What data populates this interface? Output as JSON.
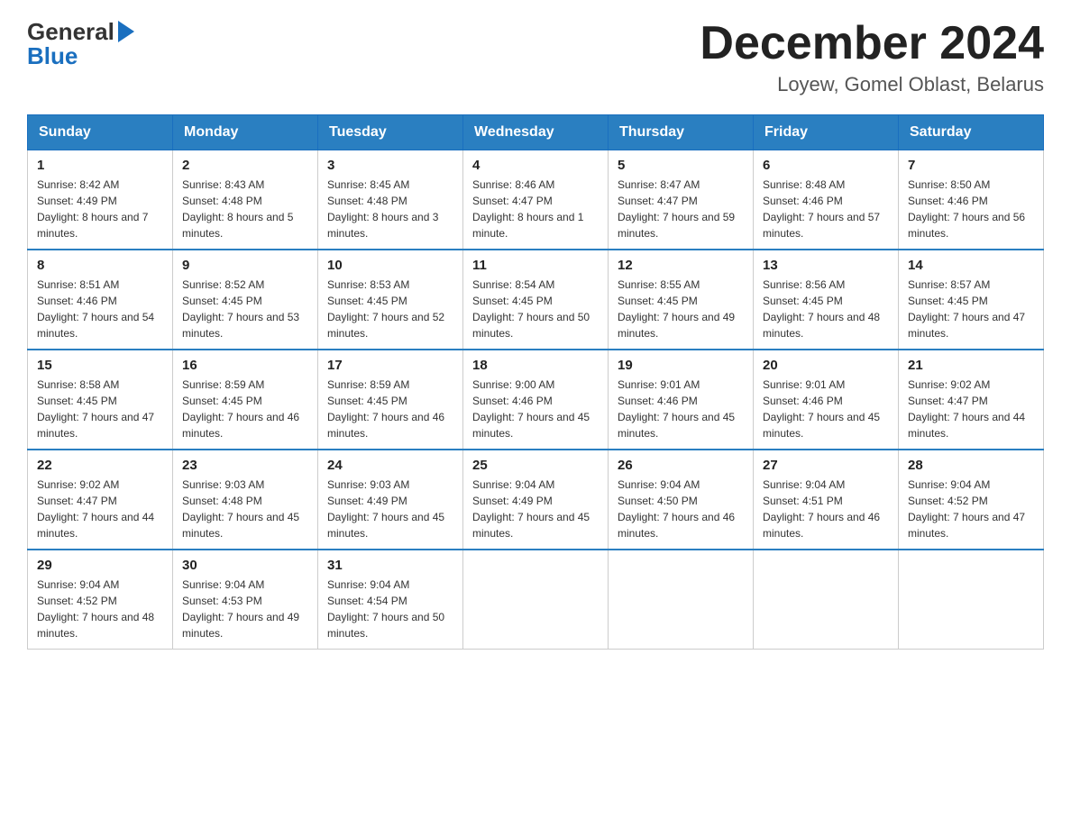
{
  "header": {
    "logo_general": "General",
    "logo_blue": "Blue",
    "month_title": "December 2024",
    "location": "Loyew, Gomel Oblast, Belarus"
  },
  "days_of_week": [
    "Sunday",
    "Monday",
    "Tuesday",
    "Wednesday",
    "Thursday",
    "Friday",
    "Saturday"
  ],
  "weeks": [
    [
      {
        "day": "1",
        "sunrise": "8:42 AM",
        "sunset": "4:49 PM",
        "daylight": "8 hours and 7 minutes."
      },
      {
        "day": "2",
        "sunrise": "8:43 AM",
        "sunset": "4:48 PM",
        "daylight": "8 hours and 5 minutes."
      },
      {
        "day": "3",
        "sunrise": "8:45 AM",
        "sunset": "4:48 PM",
        "daylight": "8 hours and 3 minutes."
      },
      {
        "day": "4",
        "sunrise": "8:46 AM",
        "sunset": "4:47 PM",
        "daylight": "8 hours and 1 minute."
      },
      {
        "day": "5",
        "sunrise": "8:47 AM",
        "sunset": "4:47 PM",
        "daylight": "7 hours and 59 minutes."
      },
      {
        "day": "6",
        "sunrise": "8:48 AM",
        "sunset": "4:46 PM",
        "daylight": "7 hours and 57 minutes."
      },
      {
        "day": "7",
        "sunrise": "8:50 AM",
        "sunset": "4:46 PM",
        "daylight": "7 hours and 56 minutes."
      }
    ],
    [
      {
        "day": "8",
        "sunrise": "8:51 AM",
        "sunset": "4:46 PM",
        "daylight": "7 hours and 54 minutes."
      },
      {
        "day": "9",
        "sunrise": "8:52 AM",
        "sunset": "4:45 PM",
        "daylight": "7 hours and 53 minutes."
      },
      {
        "day": "10",
        "sunrise": "8:53 AM",
        "sunset": "4:45 PM",
        "daylight": "7 hours and 52 minutes."
      },
      {
        "day": "11",
        "sunrise": "8:54 AM",
        "sunset": "4:45 PM",
        "daylight": "7 hours and 50 minutes."
      },
      {
        "day": "12",
        "sunrise": "8:55 AM",
        "sunset": "4:45 PM",
        "daylight": "7 hours and 49 minutes."
      },
      {
        "day": "13",
        "sunrise": "8:56 AM",
        "sunset": "4:45 PM",
        "daylight": "7 hours and 48 minutes."
      },
      {
        "day": "14",
        "sunrise": "8:57 AM",
        "sunset": "4:45 PM",
        "daylight": "7 hours and 47 minutes."
      }
    ],
    [
      {
        "day": "15",
        "sunrise": "8:58 AM",
        "sunset": "4:45 PM",
        "daylight": "7 hours and 47 minutes."
      },
      {
        "day": "16",
        "sunrise": "8:59 AM",
        "sunset": "4:45 PM",
        "daylight": "7 hours and 46 minutes."
      },
      {
        "day": "17",
        "sunrise": "8:59 AM",
        "sunset": "4:45 PM",
        "daylight": "7 hours and 46 minutes."
      },
      {
        "day": "18",
        "sunrise": "9:00 AM",
        "sunset": "4:46 PM",
        "daylight": "7 hours and 45 minutes."
      },
      {
        "day": "19",
        "sunrise": "9:01 AM",
        "sunset": "4:46 PM",
        "daylight": "7 hours and 45 minutes."
      },
      {
        "day": "20",
        "sunrise": "9:01 AM",
        "sunset": "4:46 PM",
        "daylight": "7 hours and 45 minutes."
      },
      {
        "day": "21",
        "sunrise": "9:02 AM",
        "sunset": "4:47 PM",
        "daylight": "7 hours and 44 minutes."
      }
    ],
    [
      {
        "day": "22",
        "sunrise": "9:02 AM",
        "sunset": "4:47 PM",
        "daylight": "7 hours and 44 minutes."
      },
      {
        "day": "23",
        "sunrise": "9:03 AM",
        "sunset": "4:48 PM",
        "daylight": "7 hours and 45 minutes."
      },
      {
        "day": "24",
        "sunrise": "9:03 AM",
        "sunset": "4:49 PM",
        "daylight": "7 hours and 45 minutes."
      },
      {
        "day": "25",
        "sunrise": "9:04 AM",
        "sunset": "4:49 PM",
        "daylight": "7 hours and 45 minutes."
      },
      {
        "day": "26",
        "sunrise": "9:04 AM",
        "sunset": "4:50 PM",
        "daylight": "7 hours and 46 minutes."
      },
      {
        "day": "27",
        "sunrise": "9:04 AM",
        "sunset": "4:51 PM",
        "daylight": "7 hours and 46 minutes."
      },
      {
        "day": "28",
        "sunrise": "9:04 AM",
        "sunset": "4:52 PM",
        "daylight": "7 hours and 47 minutes."
      }
    ],
    [
      {
        "day": "29",
        "sunrise": "9:04 AM",
        "sunset": "4:52 PM",
        "daylight": "7 hours and 48 minutes."
      },
      {
        "day": "30",
        "sunrise": "9:04 AM",
        "sunset": "4:53 PM",
        "daylight": "7 hours and 49 minutes."
      },
      {
        "day": "31",
        "sunrise": "9:04 AM",
        "sunset": "4:54 PM",
        "daylight": "7 hours and 50 minutes."
      },
      null,
      null,
      null,
      null
    ]
  ]
}
